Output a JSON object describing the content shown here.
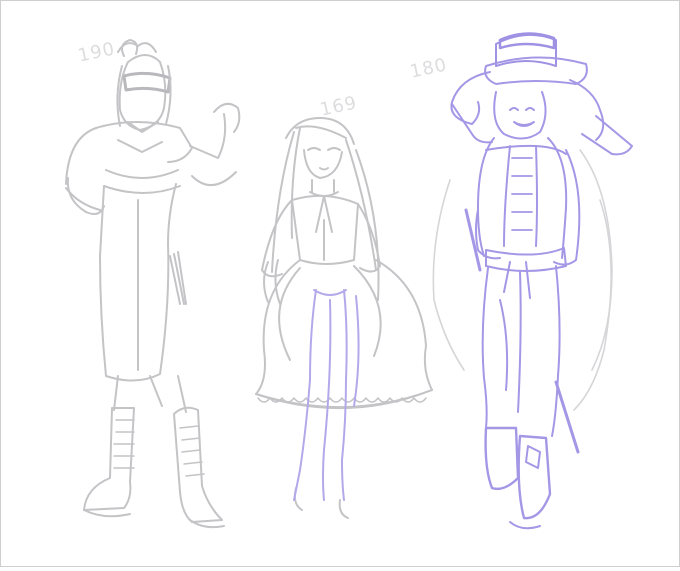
{
  "colors": {
    "background": "#ffffff",
    "sketch_gray": "#c7c7c9",
    "sketch_gray_dark": "#b3b3b6",
    "sketch_lavender": "#a497e6",
    "sketch_lavender_light": "#c9c1f0"
  },
  "labels": {
    "left_height": "190",
    "middle_height": "169",
    "right_height": "180"
  }
}
